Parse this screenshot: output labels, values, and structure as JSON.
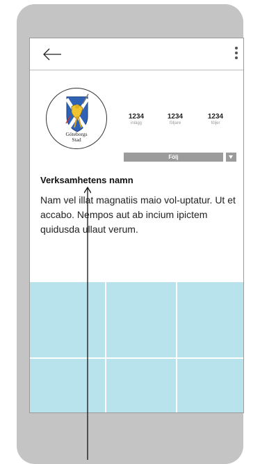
{
  "profile": {
    "logo_text_line1": "Göteborgs",
    "logo_text_line2": "Stad",
    "stats": [
      {
        "value": "1234",
        "label": "inlägg"
      },
      {
        "value": "1234",
        "label": "följare"
      },
      {
        "value": "1234",
        "label": "följer"
      }
    ],
    "follow_label": "Följ",
    "name": "Verksamhetens namn",
    "description": "Nam vel illat magnatiis maio vol-uptatur. Ut et accabo. Nempos aut ab incium ipictem quidusda ullaut verum."
  },
  "colors": {
    "phone_frame": "#c4c4c4",
    "grid_cell": "#b8e2ec",
    "button": "#9b9b9b"
  },
  "icons": {
    "back": "arrow-left-icon",
    "more": "kebab-menu-icon",
    "dropdown": "triangle-down-icon",
    "logo": "goteborgs-stad-crest"
  }
}
